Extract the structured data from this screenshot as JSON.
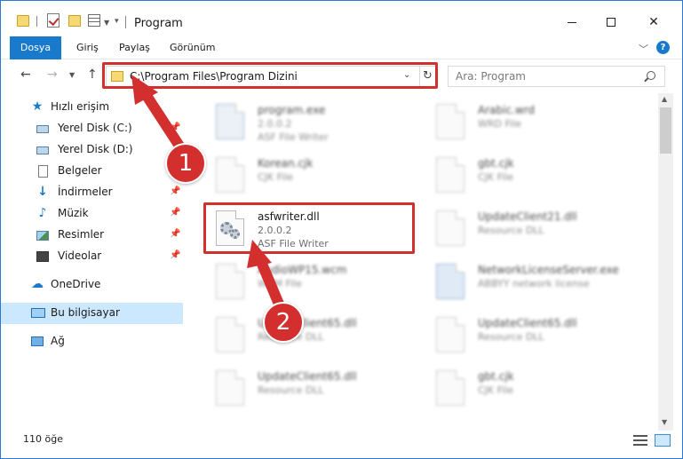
{
  "window": {
    "title": "Program"
  },
  "ribbon": {
    "tabs": [
      "Dosya",
      "Giriş",
      "Paylaş",
      "Görünüm"
    ],
    "help": "?"
  },
  "nav": {
    "address": "C:\\Program Files\\Program Dizini",
    "search_placeholder": "Ara: Program"
  },
  "sidebar": {
    "items": [
      {
        "label": "Hızlı erişim",
        "icon": "star-icon",
        "level": 0
      },
      {
        "label": "Yerel Disk (C:)",
        "icon": "drive-icon",
        "level": 1,
        "pinned": true
      },
      {
        "label": "Yerel Disk (D:)",
        "icon": "drive-icon",
        "level": 1,
        "pinned": false
      },
      {
        "label": "Belgeler",
        "icon": "document-icon",
        "level": 1,
        "pinned": true
      },
      {
        "label": "İndirmeler",
        "icon": "download-icon",
        "level": 1,
        "pinned": true
      },
      {
        "label": "Müzik",
        "icon": "music-icon",
        "level": 1,
        "pinned": true
      },
      {
        "label": "Resimler",
        "icon": "pictures-icon",
        "level": 1,
        "pinned": true
      },
      {
        "label": "Videolar",
        "icon": "video-icon",
        "level": 1,
        "pinned": true
      },
      {
        "label": "OneDrive",
        "icon": "cloud-icon",
        "level": 0
      },
      {
        "label": "Bu bilgisayar",
        "icon": "computer-icon",
        "level": 0,
        "selected": true
      },
      {
        "label": "Ağ",
        "icon": "network-icon",
        "level": 0
      }
    ]
  },
  "files": [
    {
      "name": "program.exe",
      "sub1": "2.0.0.2",
      "sub2": "ASF File Writer",
      "type": "exe"
    },
    {
      "name": "Arabic.wrd",
      "sub1": "WRD File",
      "sub2": "",
      "type": "file"
    },
    {
      "name": "Korean.cjk",
      "sub1": "CJK File",
      "sub2": "",
      "type": "file"
    },
    {
      "name": "gbt.cjk",
      "sub1": "CJK File",
      "sub2": "",
      "type": "file"
    },
    {
      "name": "asfwriter.dll",
      "sub1": "2.0.0.2",
      "sub2": "ASF File Writer",
      "type": "dll",
      "highlighted": true
    },
    {
      "name": "UpdateClient21.dll",
      "sub1": "Resource DLL",
      "sub2": "",
      "type": "dll"
    },
    {
      "name": "AudioWP15.wcm",
      "sub1": "WCM File",
      "sub2": "",
      "type": "file"
    },
    {
      "name": "NetworkLicenseServer.exe",
      "sub1": "ABBYY network license",
      "sub2": "",
      "type": "exe2"
    },
    {
      "name": "UpdateClient65.dll",
      "sub1": "Resource DLL",
      "sub2": "",
      "type": "dll"
    },
    {
      "name": "UpdateClient65.dll",
      "sub1": "Resource DLL",
      "sub2": "",
      "type": "dll"
    },
    {
      "name": "UpdateClient65.dll",
      "sub1": "Resource DLL",
      "sub2": "",
      "type": "dll"
    },
    {
      "name": "gbt.cjk",
      "sub1": "CJK File",
      "sub2": "",
      "type": "file"
    }
  ],
  "status": {
    "count": "110 öğe"
  },
  "callouts": [
    {
      "label": "1"
    },
    {
      "label": "2"
    }
  ],
  "colors": {
    "accent": "#1979ca",
    "highlight": "#d32f2f",
    "selected": "#cce8ff"
  }
}
